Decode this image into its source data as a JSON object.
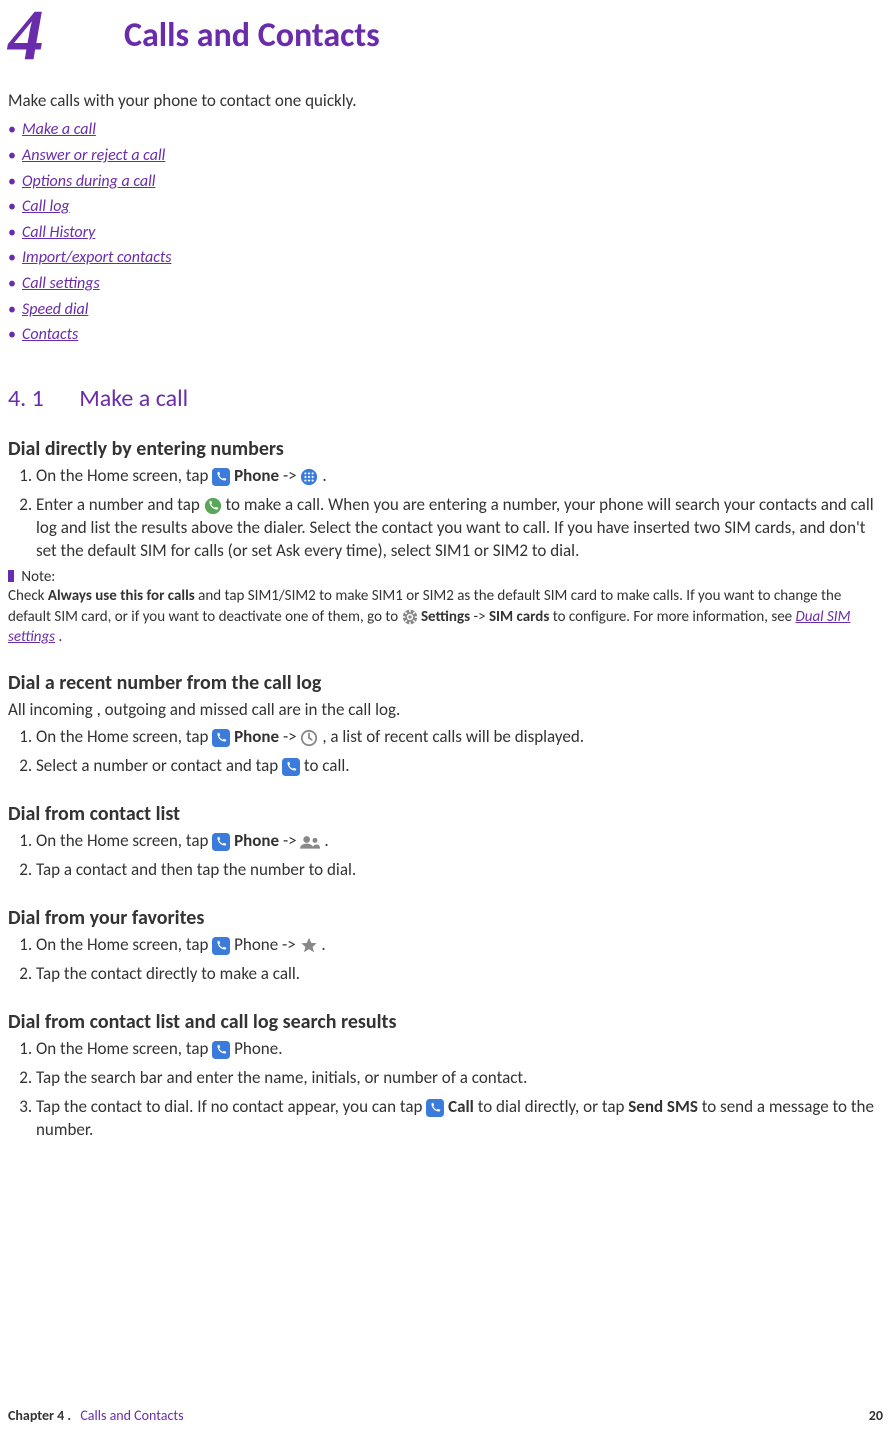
{
  "header": {
    "chapter_number": "4",
    "chapter_title": "Calls and Contacts"
  },
  "intro": "Make calls with your phone to contact one quickly.",
  "toc": [
    "Make a call",
    "Answer or reject a call",
    "Options during a call",
    "Call log",
    "Call History",
    "Import/export contacts",
    "Call settings",
    "Speed dial",
    "Contacts"
  ],
  "section": {
    "number": "4. 1",
    "title": "Make a call"
  },
  "sub1": {
    "title": "Dial directly by entering numbers",
    "step1_a": "On the Home screen, tap ",
    "step1_b": " Phone",
    "step1_c": " -> ",
    "step1_d": ".",
    "step2_a": "Enter a number and tap ",
    "step2_b": " to make a call. When you are entering a number, your phone will search your contacts and call log and list the results above the dialer. Select the contact you want to call. If you have inserted two SIM cards, and don't set the default SIM for calls (or set Ask every time), select SIM1 or SIM2 to dial.",
    "note_label": " Note:",
    "note_a": "Check ",
    "note_b": "Always use this for calls",
    "note_c": " and tap SIM1/SIM2 to make SIM1 or SIM2 as the default SIM card to make calls. If you want to change the default SIM card, or if you want to deactivate one of them, go to ",
    "note_d": " Settings",
    "note_e": " -> ",
    "note_f": "SIM cards",
    "note_g": " to configure. For more information, see ",
    "note_link": "Dual SIM settings",
    "note_h": "."
  },
  "sub2": {
    "title": "Dial a recent number from the call log",
    "desc": "All incoming , outgoing and missed call are in the call log.",
    "step1_a": "On the Home screen, tap ",
    "step1_b": " Phone",
    "step1_c": " -> ",
    "step1_d": ", a list of recent calls will be displayed.",
    "step2_a": "Select a number or contact and tap ",
    "step2_b": " to call."
  },
  "sub3": {
    "title": "Dial from contact list",
    "step1_a": "On the Home screen, tap ",
    "step1_b": " Phone",
    "step1_c": " -> ",
    "step1_d": ".",
    "step2": "Tap a contact and then tap the number to dial."
  },
  "sub4": {
    "title": "Dial from your favorites",
    "step1_a": "On the Home screen, tap ",
    "step1_b": " Phone -> ",
    "step1_c": ".",
    "step2": "Tap the contact directly to make a call."
  },
  "sub5": {
    "title": "Dial from contact list and call log search results",
    "step1_a": "On the Home screen, tap ",
    "step1_b": " Phone.",
    "step2": "Tap the search bar and enter the name, initials, or number of a contact.",
    "step3_a": "Tap the contact to dial. If no contact appear, you can tap ",
    "step3_b": " Call",
    "step3_c": " to dial directly, or tap ",
    "step3_d": "Send SMS",
    "step3_e": " to send a message to the number."
  },
  "footer": {
    "chapter": "Chapter 4 .",
    "title": "Calls and Contacts",
    "page": "20"
  }
}
